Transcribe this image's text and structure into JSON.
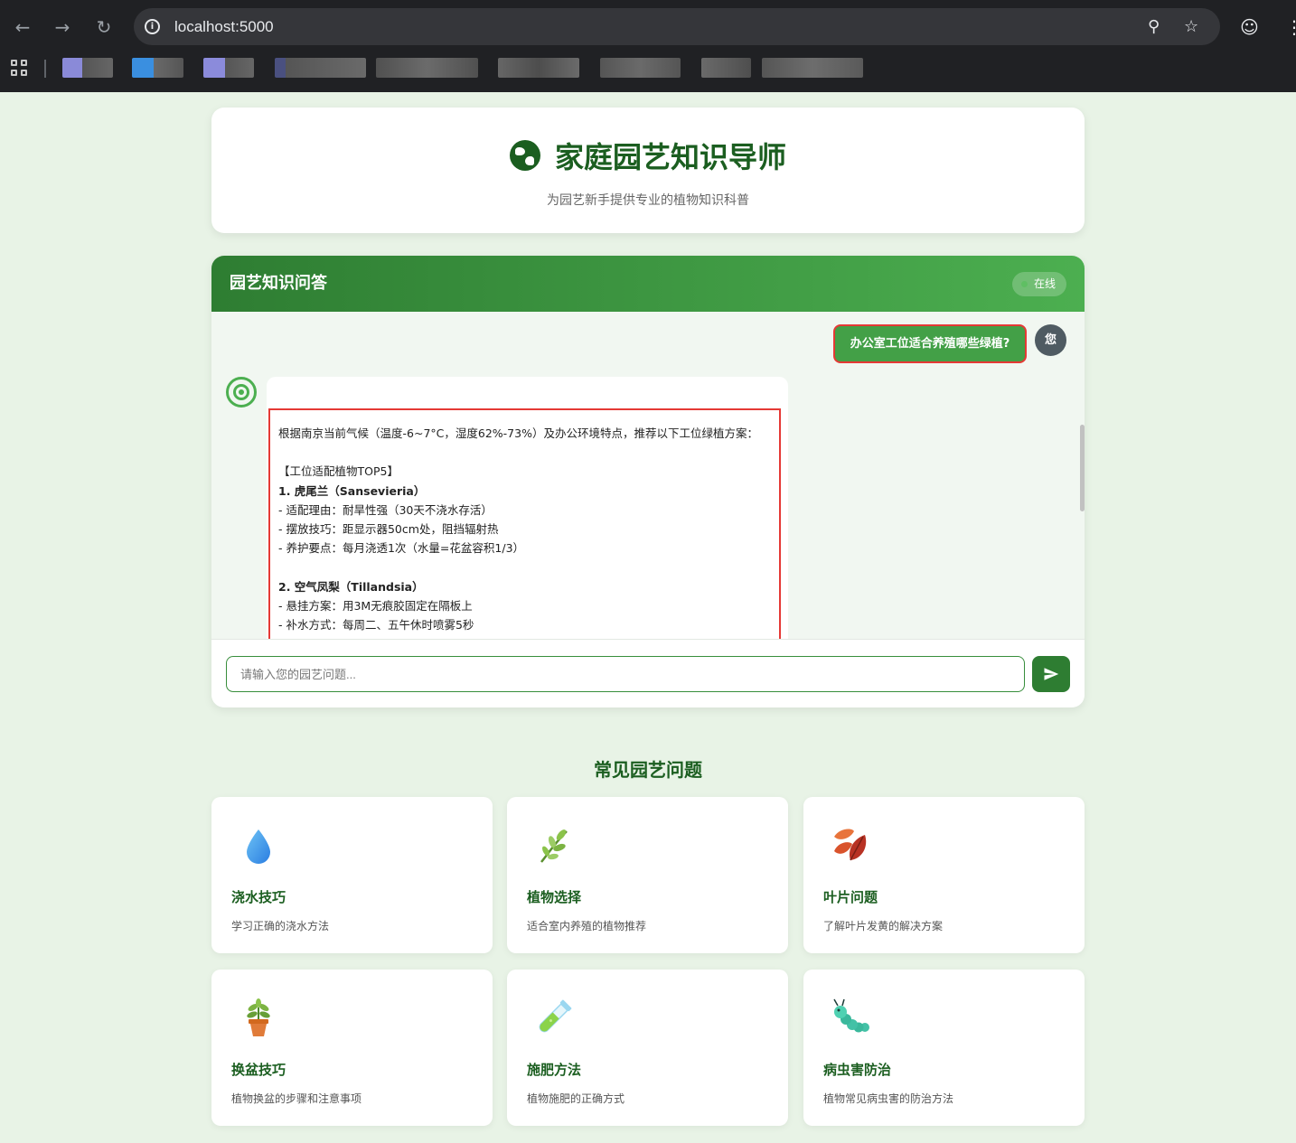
{
  "browser": {
    "url": "localhost:5000"
  },
  "header": {
    "title": "家庭园艺知识导师",
    "subtitle": "为园艺新手提供专业的植物知识科普"
  },
  "chat": {
    "title": "园艺知识问答",
    "status": "在线",
    "user_message": "办公室工位适合养殖哪些绿植?",
    "user_avatar": "您",
    "bot_lines": [
      "根据南京当前气候（温度-6~7°C，湿度62%-73%）及办公环境特点，推荐以下工位绿植方案：",
      "",
      "【工位适配植物TOP5】",
      "1. 虎尾兰（Sansevieria）",
      "- 适配理由：耐旱性强（30天不浇水存活）",
      "- 摆放技巧：距显示器50cm处，阻挡辐射热",
      "- 养护要点：每月浇透1次（水量=花盆容积1/3）",
      "",
      "2. 空气凤梨（Tillandsia）",
      "- 悬挂方案：用3M无痕胶固定在隔板上",
      "- 补水方式：每周二、五午休时喷雾5秒"
    ],
    "input_placeholder": "请输入您的园艺问题..."
  },
  "faq": {
    "title": "常见园艺问题",
    "items": [
      {
        "icon": "water-drop-icon",
        "name": "浇水技巧",
        "desc": "学习正确的浇水方法"
      },
      {
        "icon": "herb-icon",
        "name": "植物选择",
        "desc": "适合室内养殖的植物推荐"
      },
      {
        "icon": "fallen-leaf-icon",
        "name": "叶片问题",
        "desc": "了解叶片发黄的解决方案"
      },
      {
        "icon": "potted-plant-icon",
        "name": "换盆技巧",
        "desc": "植物换盆的步骤和注意事项"
      },
      {
        "icon": "test-tube-icon",
        "name": "施肥方法",
        "desc": "植物施肥的正确方式"
      },
      {
        "icon": "bug-icon",
        "name": "病虫害防治",
        "desc": "植物常见病虫害的防治方法"
      }
    ]
  },
  "colors": {
    "brand_green": "#2e7d32",
    "title_green": "#1b5e20",
    "highlight_red": "#e53935"
  }
}
